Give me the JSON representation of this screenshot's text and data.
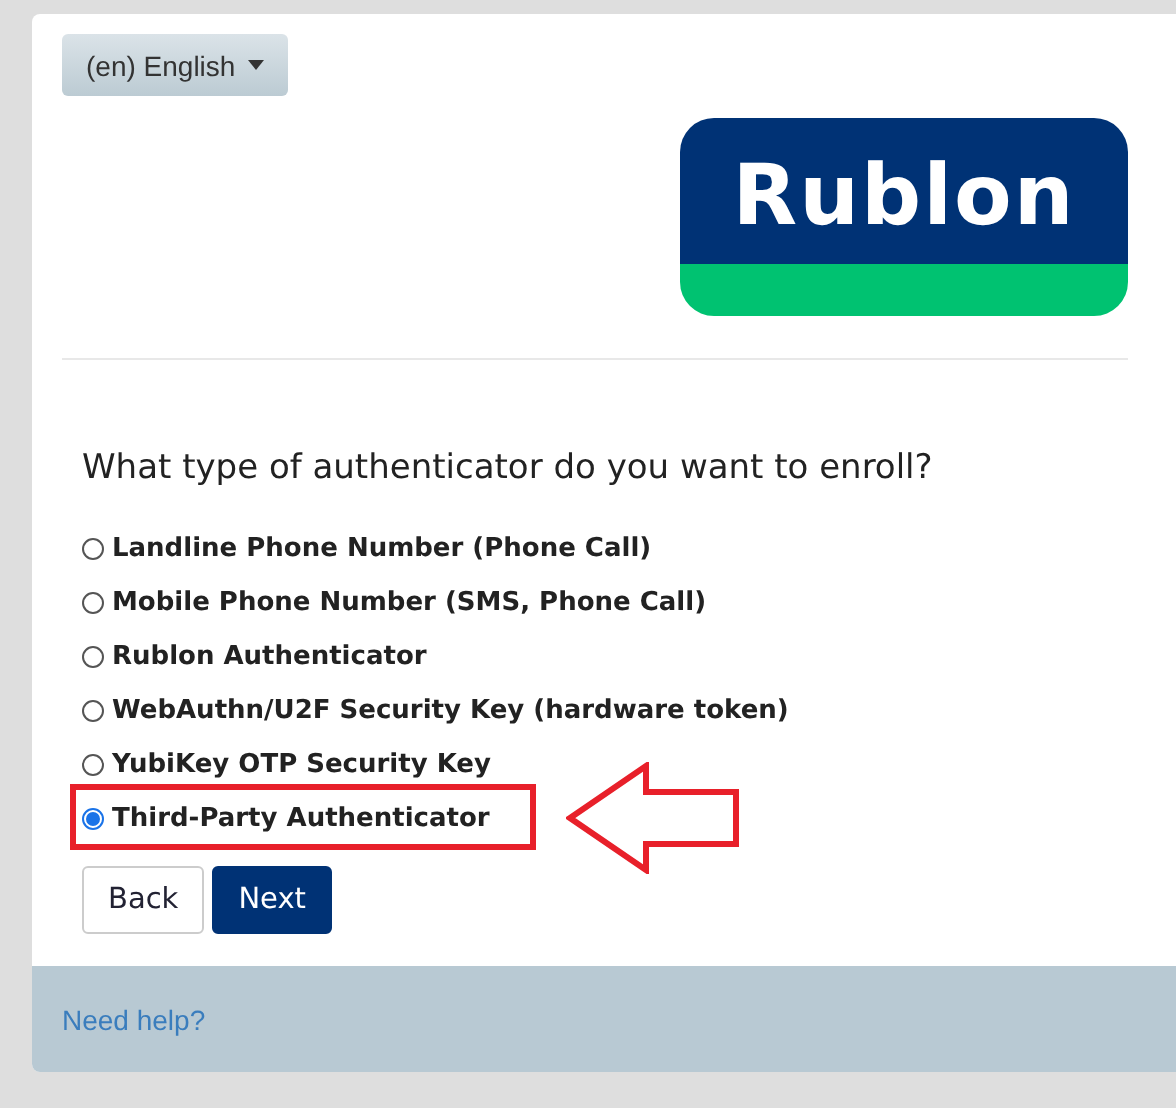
{
  "language_button": {
    "label": "(en) English"
  },
  "logo": {
    "text": "Rublon"
  },
  "question": "What type of authenticator do you want to enroll?",
  "options": [
    {
      "label": "Landline Phone Number (Phone Call)",
      "selected": false,
      "highlighted": false
    },
    {
      "label": "Mobile Phone Number (SMS, Phone Call)",
      "selected": false,
      "highlighted": false
    },
    {
      "label": "Rublon Authenticator",
      "selected": false,
      "highlighted": false
    },
    {
      "label": "WebAuthn/U2F Security Key (hardware token)",
      "selected": false,
      "highlighted": false
    },
    {
      "label": "YubiKey OTP Security Key",
      "selected": false,
      "highlighted": false
    },
    {
      "label": "Third-Party Authenticator",
      "selected": true,
      "highlighted": true
    }
  ],
  "buttons": [
    {
      "label": "Back",
      "kind": "secondary"
    },
    {
      "label": "Next",
      "kind": "primary"
    }
  ],
  "footer": {
    "link": "Need help?"
  }
}
